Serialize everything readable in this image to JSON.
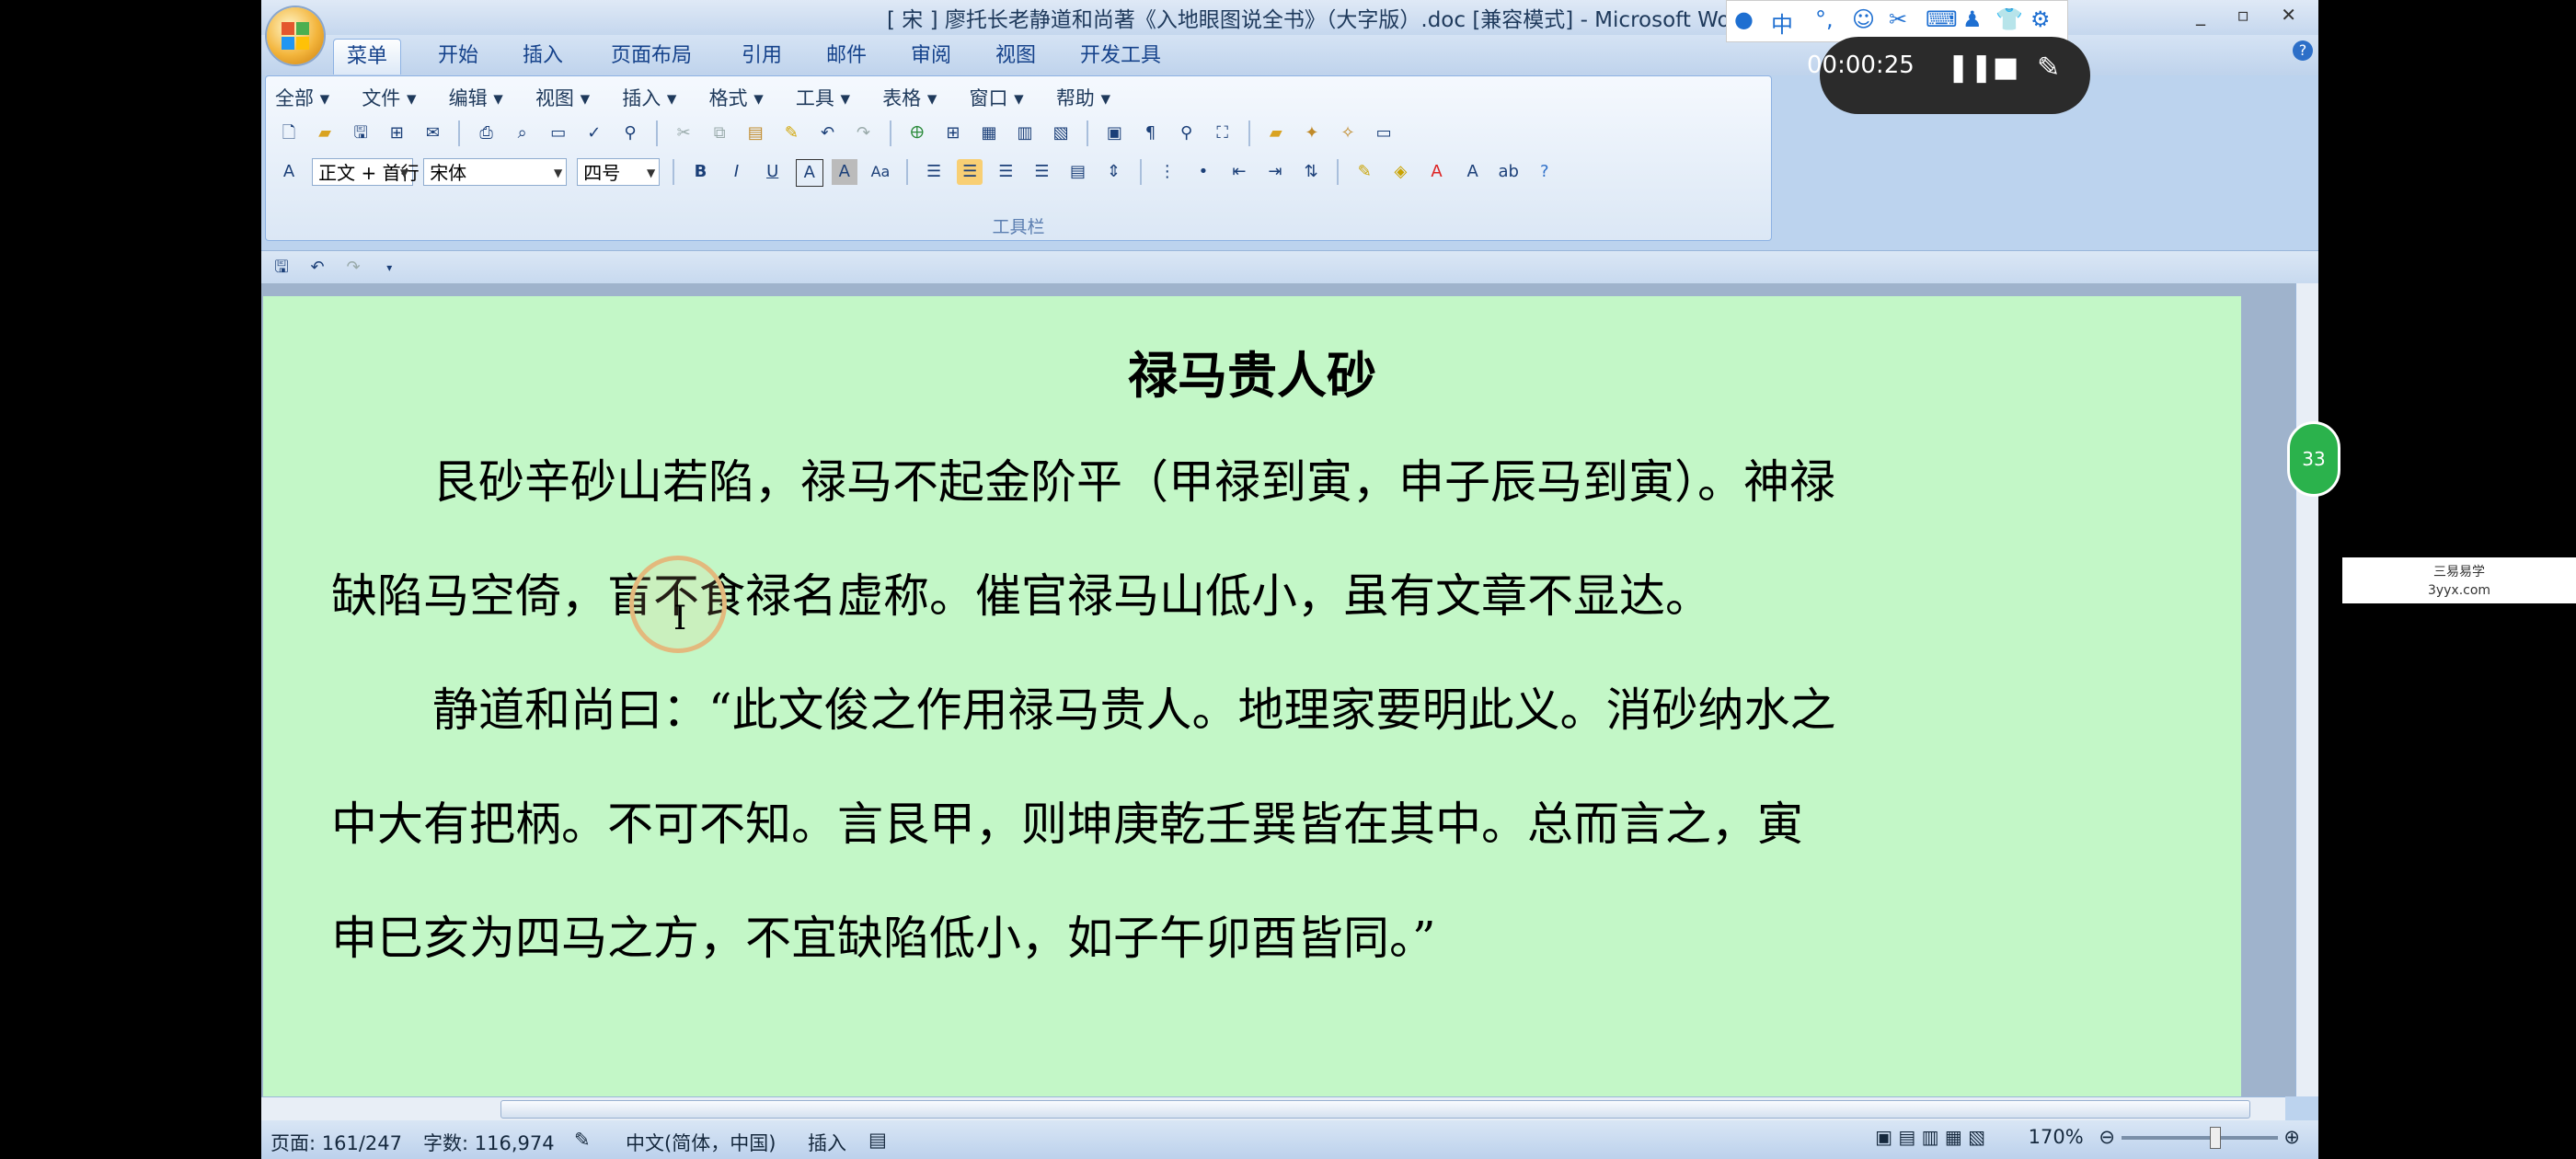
{
  "window": {
    "title": "[ 宋 ] 廖托长老静道和尚著《入地眼图说全书》（大字版）.doc [兼容模式] - Microsoft Word",
    "controls": "_ ▫ ✕"
  },
  "tabs": [
    "菜单",
    "开始",
    "插入",
    "页面布局",
    "引用",
    "邮件",
    "审阅",
    "视图",
    "开发工具"
  ],
  "menu": [
    "全部 ▾",
    "文件 ▾",
    "编辑 ▾",
    "视图 ▾",
    "插入 ▾",
    "格式 ▾",
    "工具 ▾",
    "表格 ▾",
    "窗口 ▾",
    "帮助 ▾"
  ],
  "toolbar": {
    "style_value": "正文 + 首行",
    "font_value": "宋体",
    "size_value": "四号",
    "group_label": "工具栏",
    "bold": "B",
    "italic": "I",
    "underline": "U",
    "charborder": "A",
    "charshade": "A",
    "changecase": "Aa"
  },
  "document": {
    "title": "禄马贵人砂",
    "para1_line1": "艮砂辛砂山若陷，禄马不起金阶平（甲禄到寅，申子辰马到寅）。神禄",
    "para1_line2": "缺陷马空倚，盲不食禄名虚称。催官禄马山低小，虽有文章不显达。",
    "para2_line1": "静道和尚曰：“此文俊之作用禄马贵人。地理家要明此义。消砂纳水之",
    "para2_line2": "中大有把柄。不可不知。言艮甲，则坤庚乾壬巽皆在其中。总而言之，寅",
    "para2_line3": "申巳亥为四马之方，不宜缺陷低小，如子午卯酉皆同。”"
  },
  "status": {
    "page": "页面: 161/247",
    "words": "字数: 116,974",
    "lang": "中文(简体，中国)",
    "mode": "插入",
    "zoom": "170%"
  },
  "ime": {
    "mode": "中"
  },
  "recorder": {
    "time": "00:00:25"
  },
  "watermark": {
    "line1": "三易易学",
    "line2": "3yyx.com"
  },
  "side_badge": "33",
  "colors": {
    "page_bg": "#c3f7c7",
    "ribbon_text": "#15428b"
  }
}
